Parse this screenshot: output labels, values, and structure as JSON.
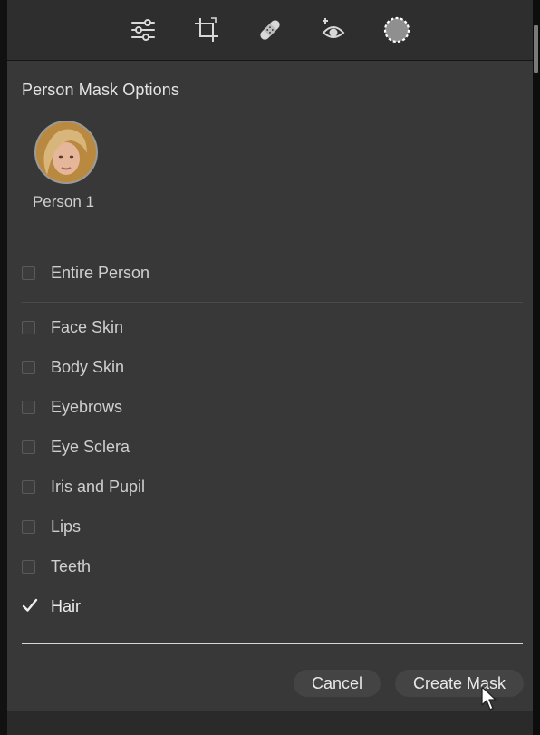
{
  "toolbar": {
    "tools": [
      {
        "icon": "sliders-icon",
        "label": "Edit"
      },
      {
        "icon": "crop-icon",
        "label": "Crop"
      },
      {
        "icon": "bandage-icon",
        "label": "Healing"
      },
      {
        "icon": "red-eye-icon",
        "label": "Red Eye"
      },
      {
        "icon": "masking-icon",
        "label": "Masking"
      }
    ]
  },
  "panel": {
    "title": "Person Mask Options",
    "person": {
      "name": "Person 1"
    },
    "entire_person": {
      "label": "Entire Person",
      "checked": false
    },
    "options": [
      {
        "label": "Face Skin",
        "checked": false
      },
      {
        "label": "Body Skin",
        "checked": false
      },
      {
        "label": "Eyebrows",
        "checked": false
      },
      {
        "label": "Eye Sclera",
        "checked": false
      },
      {
        "label": "Iris and Pupil",
        "checked": false
      },
      {
        "label": "Lips",
        "checked": false
      },
      {
        "label": "Teeth",
        "checked": false
      },
      {
        "label": "Hair",
        "checked": true
      }
    ],
    "buttons": {
      "cancel": "Cancel",
      "create": "Create Mask"
    }
  },
  "colors": {
    "panel_bg": "#383838",
    "toolbar_bg": "#2e2e2e",
    "text": "#cfcfcf",
    "button_bg": "#444444"
  }
}
